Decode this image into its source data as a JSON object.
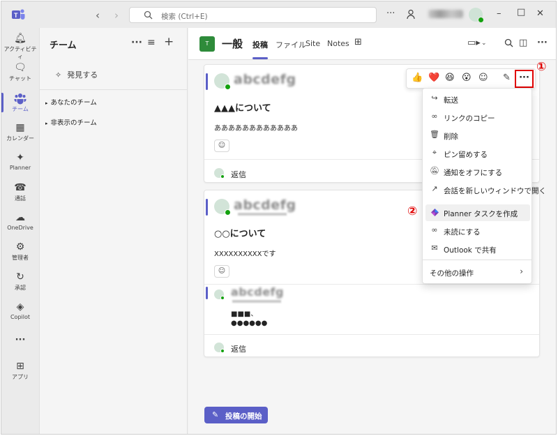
{
  "titlebar": {
    "search_placeholder": "検索 (Ctrl+E)",
    "icons": [
      "teams-logo",
      "back-arrow",
      "forward-arrow",
      "more-options",
      "people-icon",
      "minimize",
      "maximize",
      "close"
    ]
  },
  "rail": {
    "items": [
      {
        "label": "アクティビティ",
        "icon": "bell"
      },
      {
        "label": "チャット",
        "icon": "chat"
      },
      {
        "label": "チーム",
        "icon": "teams",
        "active": true
      },
      {
        "label": "カレンダー",
        "icon": "calendar"
      },
      {
        "label": "Planner",
        "icon": "planner"
      },
      {
        "label": "通話",
        "icon": "phone"
      },
      {
        "label": "OneDrive",
        "icon": "cloud"
      },
      {
        "label": "管理者",
        "icon": "admin"
      },
      {
        "label": "承認",
        "icon": "approvals"
      },
      {
        "label": "Copilot",
        "icon": "copilot"
      },
      {
        "label": "···",
        "icon": "more"
      },
      {
        "label": "アプリ",
        "icon": "apps"
      }
    ]
  },
  "teamlist": {
    "title": "チーム",
    "discover": "発見する",
    "groups": [
      "あなたのチーム",
      "非表示のチーム"
    ]
  },
  "channel": {
    "badge": "T",
    "name": "一般",
    "tabs": [
      "投稿",
      "ファイル",
      "Site",
      "Notes"
    ]
  },
  "posts": [
    {
      "author_blurred": "abcdefg",
      "title": "▲▲▲について",
      "body": "ああああああああああああ",
      "reply_label": "返信"
    },
    {
      "author_blurred": "abcdefg",
      "title": "○○について",
      "body": "XXXXXXXXXXです",
      "reply_author_blurred": "abcdefg",
      "reply_line1": "■■■、",
      "reply_line2": "●●●●●●",
      "reply_label": "返信"
    }
  ],
  "reactions": [
    "👍",
    "❤️",
    "😆",
    "😮"
  ],
  "markers": {
    "one": "①",
    "two": "②"
  },
  "more_label": "···",
  "menu": {
    "items": [
      {
        "label": "転送",
        "icon": "forward"
      },
      {
        "label": "リンクのコピー",
        "icon": "link"
      },
      {
        "label": "削除",
        "icon": "trash"
      },
      {
        "label": "ピン留めする",
        "icon": "pin"
      },
      {
        "label": "通知をオフにする",
        "icon": "bell-off"
      },
      {
        "label": "会話を新しいウィンドウで開く",
        "icon": "open-window"
      },
      {
        "label": "Planner タスクを作成",
        "icon": "planner",
        "highlighted": true
      },
      {
        "label": "未読にする",
        "icon": "glasses"
      },
      {
        "label": "Outlook で共有",
        "icon": "mail"
      }
    ],
    "more_actions": "その他の操作"
  },
  "start_post": "投稿の開始",
  "colors": {
    "accent": "#5b5fc7",
    "marker": "#e00000",
    "presence": "#13a10e",
    "channel_badge": "#2e8b3a"
  }
}
